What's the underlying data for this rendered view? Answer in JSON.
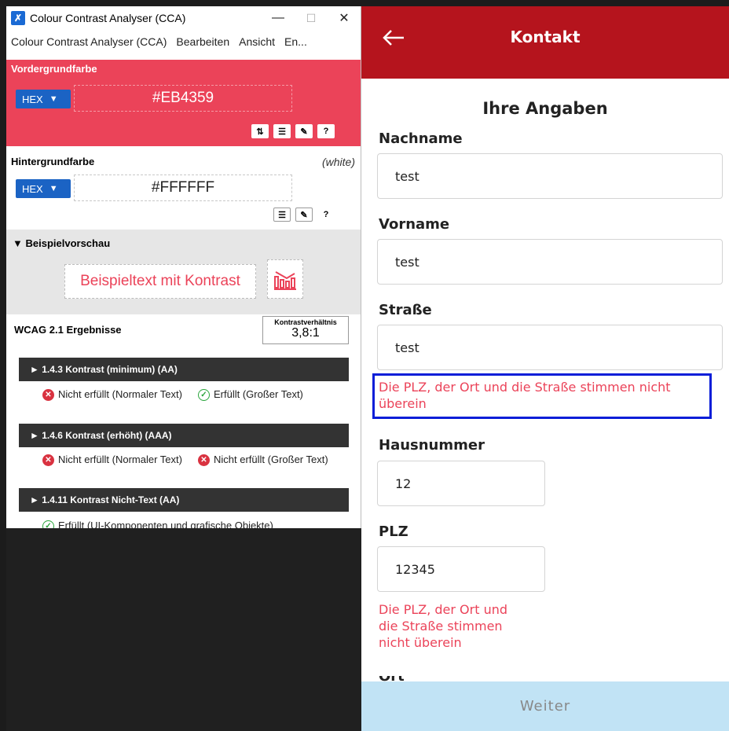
{
  "cca": {
    "window_title": "Colour Contrast Analyser (CCA)",
    "app_icon_glyph": "✗",
    "window_controls": {
      "minimize": "—",
      "maximize": "☐",
      "close": "✕"
    },
    "menu": [
      "Colour Contrast Analyser (CCA)",
      "Bearbeiten",
      "Ansicht",
      "En..."
    ],
    "foreground": {
      "label": "Vordergrundfarbe",
      "format": "HEX",
      "value": "#EB4359",
      "color": "#EB4359",
      "tools": [
        "⇅",
        "☰",
        "✎",
        "?"
      ]
    },
    "background": {
      "label": "Hintergrundfarbe",
      "name_note": "(white)",
      "format": "HEX",
      "value": "#FFFFFF",
      "tools": [
        "☰",
        "✎",
        "?"
      ]
    },
    "preview": {
      "label": "▼ Beispielvorschau",
      "sample_text": "Beispieltext mit Kontrast"
    },
    "results": {
      "heading": "WCAG 2.1 Ergebnisse",
      "ratio_label": "Kontrastverhältnis",
      "ratio_value": "3,8:1",
      "criteria": [
        {
          "title": "► 1.4.3 Kontrast (minimum) (AA)",
          "items": [
            {
              "status": "fail",
              "text": "Nicht erfüllt (Normaler Text)"
            },
            {
              "status": "pass",
              "text": "Erfüllt (Großer Text)"
            }
          ]
        },
        {
          "title": "► 1.4.6 Kontrast (erhöht) (AAA)",
          "items": [
            {
              "status": "fail",
              "text": "Nicht erfüllt (Normaler Text)"
            },
            {
              "status": "fail",
              "text": "Nicht erfüllt (Großer Text)"
            }
          ]
        },
        {
          "title": "► 1.4.11 Kontrast Nicht-Text (AA)",
          "items": [
            {
              "status": "pass",
              "text": "Erfüllt (UI-Komponenten und grafische Objekte)"
            }
          ]
        }
      ]
    }
  },
  "app": {
    "title": "Kontakt",
    "back_icon": "arrow-left",
    "brand_color": "#B5141D",
    "section_heading": "Ihre Angaben",
    "fields": [
      {
        "label": "Nachname",
        "value": "test"
      },
      {
        "label": "Vorname",
        "value": "test"
      },
      {
        "label": "Straße",
        "value": "test"
      },
      {
        "label": "Hausnummer",
        "value": "12"
      },
      {
        "label": "PLZ",
        "value": "12345"
      }
    ],
    "error_strasse": "Die PLZ, der Ort und die Straße stimmen nicht überein",
    "error_plz_lines": [
      "Die PLZ, der Ort und",
      "die Straße stimmen",
      "nicht überein"
    ],
    "next_label_partial": "Ort",
    "button_label": "Weiter"
  }
}
